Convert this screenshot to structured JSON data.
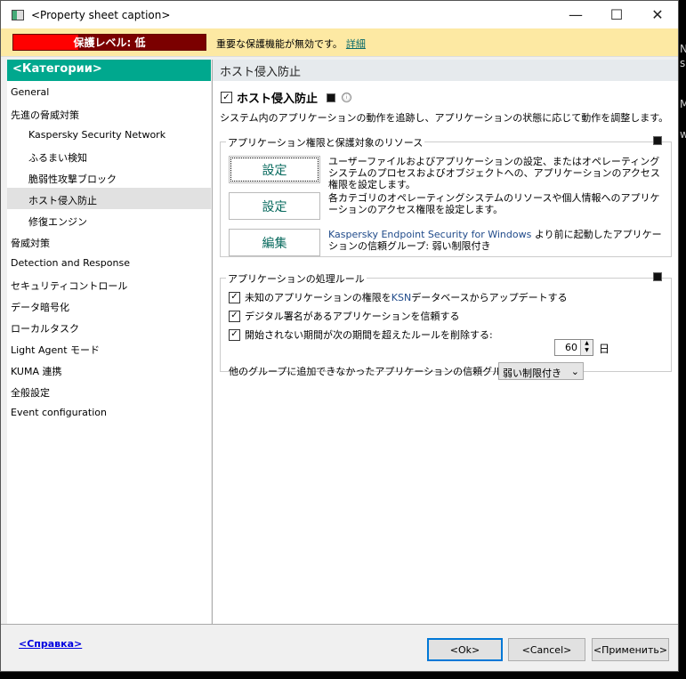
{
  "window": {
    "title": "<Property sheet caption>",
    "minimize": "—",
    "maximize": "☐",
    "close": "✕"
  },
  "banner": {
    "level": "保護レベル: 低",
    "level_fraction": 0.34,
    "message": "重要な保護機能が無効です。",
    "link": "詳細"
  },
  "sidebar": {
    "header": "<Категории>",
    "items": [
      {
        "label": "General"
      },
      {
        "label": "先進の脅威対策"
      },
      {
        "label": "Kaspersky Security Network"
      },
      {
        "label": "ふるまい検知"
      },
      {
        "label": "脆弱性攻撃ブロック"
      },
      {
        "label": "ホスト侵入防止"
      },
      {
        "label": "修復エンジン"
      },
      {
        "label": "脅威対策"
      },
      {
        "label": "Detection and Response"
      },
      {
        "label": "セキュリティコントロール"
      },
      {
        "label": "データ暗号化"
      },
      {
        "label": "ローカルタスク"
      },
      {
        "label": "Light Agent モード"
      },
      {
        "label": "KUMA 連携"
      },
      {
        "label": "全般設定"
      },
      {
        "label": "Event configuration"
      }
    ]
  },
  "main": {
    "header": "ホスト侵入防止",
    "enable_label": "ホスト侵入防止",
    "info_icon": "ⓘ",
    "description": "システム内のアプリケーションの動作を追跡し、アプリケーションの状態に応じて動作を調整します。",
    "group1": {
      "title": "アプリケーション権限と保護対象のリソース",
      "rows": [
        {
          "button": "設定",
          "text": "ユーザーファイルおよびアプリケーションの設定、またはオペレーティングシステムのプロセスおよびオブジェクトへの、アプリケーションのアクセス権限を設定します。"
        },
        {
          "button": "設定",
          "text": "各カテゴリのオペレーティングシステムのリソースや個人情報へのアプリケーションのアクセス権限を設定します。"
        },
        {
          "button": "編集",
          "text_prefix": "Kaspersky Endpoint Security for Windows",
          "text": " より前に起動したアプリケーションの信頼グループ: 弱い制限付き"
        }
      ]
    },
    "group2": {
      "title": "アプリケーションの処理ルール",
      "ksn_pre": "未知のアプリケーションの権限を ",
      "ksn": "KSN",
      "ksn_post": " データベースからアップデートする",
      "trust_signed": "デジタル署名があるアプリケーションを信頼する",
      "delete_rules": "開始されない期間が次の期間を超えたルールを削除する:",
      "days_value": "60",
      "days_unit": "日",
      "group_label": "他のグループに追加できなかったアプリケーションの信頼グループ",
      "group_value": "弱い制限付き"
    }
  },
  "footer": {
    "help": "<Справка>",
    "ok": "<Ok>",
    "cancel": "<Cancel>",
    "apply": "<Применить>"
  },
  "background_window": {
    "t1": "N",
    "t2": "s",
    "t3": "Ma",
    "t4": "wi"
  }
}
